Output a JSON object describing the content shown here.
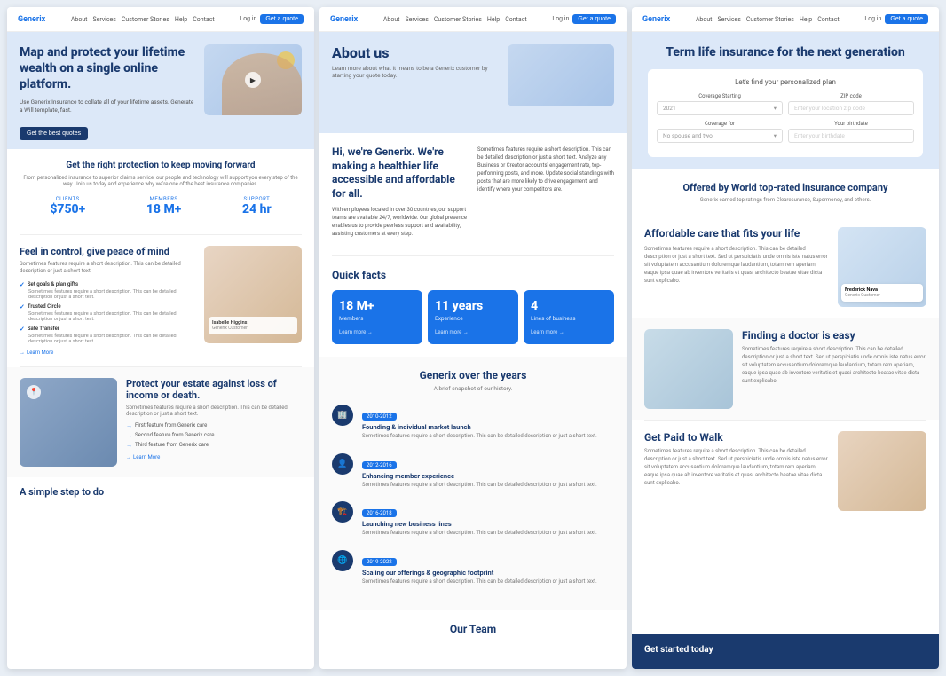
{
  "screenshots": [
    {
      "id": "s1",
      "nav": {
        "logo": "Generix",
        "links": [
          "About",
          "Services",
          "Customer Stories",
          "Help",
          "Contact"
        ],
        "login": "Log in",
        "cta": "Get a quote"
      },
      "hero": {
        "title": "Map and protect your lifetime wealth on a single online platform.",
        "subtitle": "Use Generix Insurance to collate all of your lifetime assets. Generate a Will template, fast.",
        "cta": "Get the best quotes",
        "play_label": "▶"
      },
      "stats_section": {
        "title": "Get the right protection to keep moving forward",
        "subtitle": "From personalized insurance to superior claims service, our people and technology will support you every step of the way. Join us today and experience why we're one of the best insurance companies.",
        "stats": [
          {
            "label": "CLIENTS",
            "value": "$750+",
            "sub": ""
          },
          {
            "label": "MEMBERS",
            "value": "18 M+",
            "sub": ""
          },
          {
            "label": "SUPPORT",
            "value": "24 hr",
            "sub": ""
          }
        ]
      },
      "peace": {
        "title": "Feel in control, give peace of mind",
        "subtitle": "Sometimes features require a short description. This can be detailed description or just a short text.",
        "items": [
          {
            "title": "Set goals & plan gifts",
            "desc": "Sometimes features require a short description. This can be detailed description or just a short text."
          },
          {
            "title": "Trusted Circle",
            "desc": "Sometimes features require a short description. This can be detailed description or just a short text."
          },
          {
            "title": "Safe Transfer",
            "desc": "Sometimes features require a short description. This can be detailed description or just a short text."
          }
        ],
        "learn_more": "Learn More",
        "card": {
          "name": "Isabelle Higgins",
          "role": "Generix Customer"
        }
      },
      "protect": {
        "title": "Protect your estate against loss of income or death.",
        "subtitle": "Sometimes features require a short description. This can be detailed description or just a short text.",
        "items": [
          "First feature from Generix care",
          "Second feature from Generix care",
          "Third feature from Generix care"
        ],
        "learn_more": "Learn More"
      },
      "simple": {
        "title": "A simple step to do"
      }
    },
    {
      "id": "s2",
      "nav": {
        "logo": "Generix",
        "links": [
          "About",
          "Services",
          "Customer Stories",
          "Help",
          "Contact"
        ],
        "login": "Log in",
        "cta": "Get a quote"
      },
      "hero": {
        "title": "About us",
        "subtitle": "Learn more about what it means to be a Generix customer by starting your quote today."
      },
      "about": {
        "left_title": "Hi, we're Generix. We're making a healthier life accessible and affordable for all.",
        "left_desc": "With employees located in over 30 countries, our support teams are available 24/7, worldwide. Our global presence enables us to provide peerless support and availability, assisting customers at every step.",
        "right_desc": "Sometimes features require a short description. This can be detailed description or just a short text. Analyze any Business or Creator accounts' engagement rate, top-performing posts, and more. Update social standings with posts that are more likely to drive engagement, and identify where your competitors are."
      },
      "quick_facts": {
        "title": "Quick facts",
        "cards": [
          {
            "value": "18 M+",
            "label": "Members",
            "link": "Learn more →"
          },
          {
            "value": "11 years",
            "label": "Experience",
            "link": "Learn more →"
          },
          {
            "value": "4",
            "label": "Lines of business",
            "link": "Learn more →"
          }
        ]
      },
      "timeline": {
        "title": "Generix over the years",
        "subtitle": "A brief snapshot of our history.",
        "items": [
          {
            "icon": "🏢",
            "badge": "2010-2012",
            "title": "Founding & individual market launch",
            "desc": "Sometimes features require a short description. This can be detailed description or just a short text."
          },
          {
            "icon": "👤",
            "badge": "2012-2016",
            "title": "Enhancing member experience",
            "desc": "Sometimes features require a short description. This can be detailed description or just a short text."
          },
          {
            "icon": "🏗️",
            "badge": "2016-2018",
            "title": "Launching new business lines",
            "desc": "Sometimes features require a short description. This can be detailed description or just a short text."
          },
          {
            "icon": "🌐",
            "badge": "2019-2022",
            "title": "Scaling our offerings & geographic footprint",
            "desc": "Sometimes features require a short description. This can be detailed description or just a short text."
          }
        ]
      },
      "team": {
        "title": "Our Team"
      }
    },
    {
      "id": "s3",
      "nav": {
        "logo": "Generix",
        "links": [
          "About",
          "Services",
          "Customer Stories",
          "Help",
          "Contact"
        ],
        "login": "Log in",
        "cta": "Get a quote"
      },
      "hero": {
        "title": "Term life insurance for the next generation",
        "plan_finder": {
          "title": "Let's find your personalized plan",
          "fields": [
            {
              "label": "Coverage Starting",
              "value": "2021",
              "type": "select"
            },
            {
              "label": "ZIP code",
              "value": "Enter your location zip code",
              "type": "input"
            },
            {
              "label": "Coverage for",
              "value": "No spouse and two",
              "type": "select"
            },
            {
              "label": "Your birthdate",
              "value": "Enter your birthdate",
              "type": "input"
            }
          ]
        }
      },
      "rated": {
        "title": "Offered by World top-rated insurance company",
        "subtitle": "Generix earned top ratings from Clearesurance, Supermoney, and others."
      },
      "affordable": {
        "title": "Affordable care that fits your life",
        "subtitle": "Sometimes features require a short description. This can be detailed description or just a short text. Sed ut perspiciatis unde omnis iste natus error sit voluptatem accusantium doloremque laudantium, totam rem aperiam, eaque ipsa quae ab inventore veritatis et quasi architecto beatae vitae dicta sunt explicabo.",
        "card": {
          "name": "Frederick Nava",
          "role": "Generix Customer"
        }
      },
      "doctor": {
        "title": "Finding a doctor is easy",
        "subtitle": "Sometimes features require a short description. This can be detailed description or just a short text. Sed ut perspiciatis unde omnis iste natus error sit voluptatem accusantium doloremque laudantium, totam rem aperiam, eaque ipsa quae ab inventore veritatis et quasi architecto beatae vitae dicta sunt explicabo."
      },
      "walk": {
        "title": "Get Paid to Walk",
        "subtitle": "Sometimes features require a short description. This can be detailed description or just a short text. Sed ut perspiciatis unde omnis iste natus error sit voluptatem accusantium doloremque laudantium, totam rem aperiam, eaque ipsa quae ab inventore veritatis et quasi architecto beatae vitae dicta sunt explicabo."
      }
    }
  ]
}
